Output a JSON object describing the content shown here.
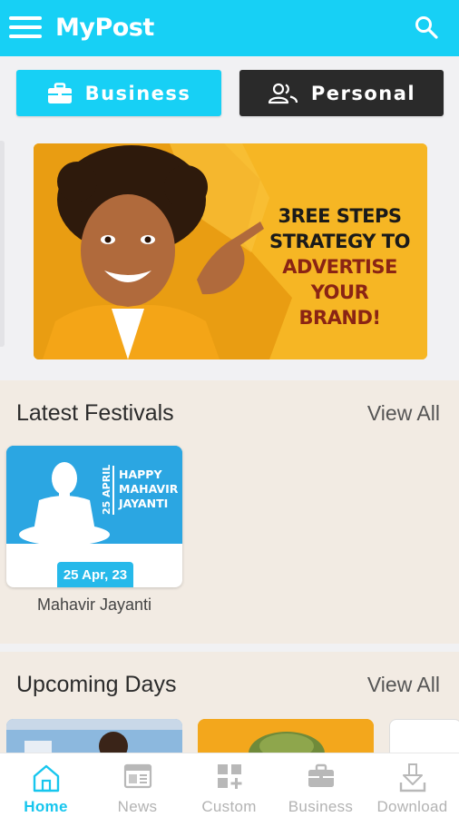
{
  "header": {
    "title": "MyPost",
    "accent": "#17d0f5"
  },
  "segments": [
    {
      "label": "Business",
      "icon": "briefcase-icon",
      "active": true
    },
    {
      "label": "Personal",
      "icon": "people-icon",
      "active": false
    }
  ],
  "banner": {
    "lines_dark": [
      "3REE STEPS",
      "STRATEGY TO"
    ],
    "lines_red": [
      "ADVERTISE YOUR",
      "BRAND!"
    ]
  },
  "latest_festivals": {
    "title": "Latest Festivals",
    "view_all": "View All",
    "items": [
      {
        "name": "Mahavir Jayanti",
        "date": "25 Apr, 23",
        "art_side": "25 APRIL",
        "art_lines": [
          "HAPPY",
          "MAHAVIR",
          "JAYANTI"
        ]
      }
    ]
  },
  "upcoming_days": {
    "title": "Upcoming Days",
    "view_all": "View All"
  },
  "bottom_nav": [
    {
      "label": "Home",
      "icon": "home-icon",
      "active": true
    },
    {
      "label": "News",
      "icon": "news-icon",
      "active": false
    },
    {
      "label": "Custom",
      "icon": "custom-grid-icon",
      "active": false
    },
    {
      "label": "Business",
      "icon": "briefcase-icon",
      "active": false
    },
    {
      "label": "Download",
      "icon": "download-icon",
      "active": false
    }
  ]
}
